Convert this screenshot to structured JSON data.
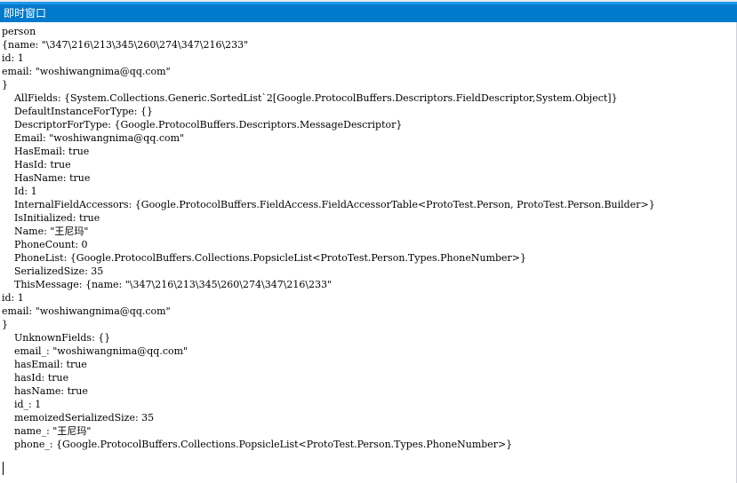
{
  "window": {
    "title": "即时窗口"
  },
  "colors": {
    "title_bar": "#007acc",
    "title_accent": "#1c97ea",
    "background": "#ffffff",
    "text": "#000000"
  },
  "output": {
    "lines": [
      "person",
      "{name: \"\\347\\216\\213\\345\\260\\274\\347\\216\\233\"",
      "id: 1",
      "email: \"woshiwangnima@qq.com\"",
      "}",
      "    AllFields: {System.Collections.Generic.SortedList`2[Google.ProtocolBuffers.Descriptors.FieldDescriptor,System.Object]}",
      "    DefaultInstanceForType: {}",
      "    DescriptorForType: {Google.ProtocolBuffers.Descriptors.MessageDescriptor}",
      "    Email: \"woshiwangnima@qq.com\"",
      "    HasEmail: true",
      "    HasId: true",
      "    HasName: true",
      "    Id: 1",
      "    InternalFieldAccessors: {Google.ProtocolBuffers.FieldAccess.FieldAccessorTable<ProtoTest.Person, ProtoTest.Person.Builder>}",
      "    IsInitialized: true",
      "    Name: \"王尼玛\"",
      "    PhoneCount: 0",
      "    PhoneList: {Google.ProtocolBuffers.Collections.PopsicleList<ProtoTest.Person.Types.PhoneNumber>}",
      "    SerializedSize: 35",
      "    ThisMessage: {name: \"\\347\\216\\213\\345\\260\\274\\347\\216\\233\"",
      "id: 1",
      "email: \"woshiwangnima@qq.com\"",
      "}",
      "    UnknownFields: {}",
      "    email_: \"woshiwangnima@qq.com\"",
      "    hasEmail: true",
      "    hasId: true",
      "    hasName: true",
      "    id_: 1",
      "    memoizedSerializedSize: 35",
      "    name_: \"王尼玛\"",
      "    phone_: {Google.ProtocolBuffers.Collections.PopsicleList<ProtoTest.Person.Types.PhoneNumber>}"
    ]
  }
}
